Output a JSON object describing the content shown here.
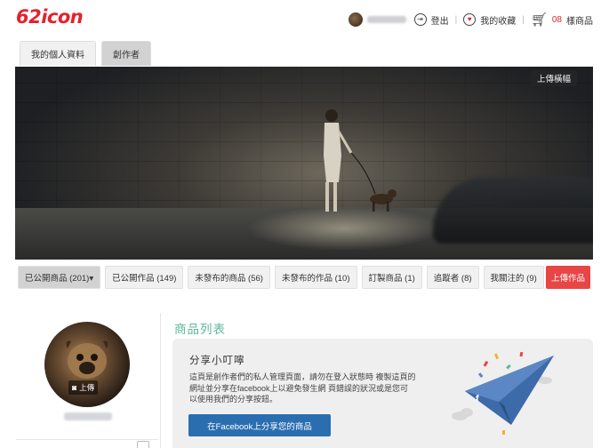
{
  "header": {
    "logo": "62icon",
    "logout_label": "登出",
    "favorites_label": "我的收藏",
    "cart_count": "08",
    "cart_label": "樣商品"
  },
  "tabs": [
    {
      "label": "我的個人資料",
      "active": false
    },
    {
      "label": "創作者",
      "active": true
    }
  ],
  "banner": {
    "upload_label": "上傳橫幅"
  },
  "subtabs": [
    {
      "label": "已公開商品 (201)▾",
      "active": true
    },
    {
      "label": "已公開作品 (149)",
      "active": false
    },
    {
      "label": "未發布的商品 (56)",
      "active": false
    },
    {
      "label": "未發布的作品 (10)",
      "active": false
    },
    {
      "label": "訂製商品 (1)",
      "active": false
    },
    {
      "label": "追蹤者 (8)",
      "active": false
    },
    {
      "label": "我關注的 (9)",
      "active": false
    }
  ],
  "upload_work_label": "上傳作品",
  "profile": {
    "upload_label": "上傳"
  },
  "main": {
    "section_title": "商品列表",
    "tip_title": "分享小叮嚀",
    "tip_body": "這頁是創作者們的私人管理頁面，請勿在登入狀態時 複製這頁的網址並分享在facebook上以避免發生網 頁錯誤的狀況或是您可以使用我們的分享按鈕。",
    "share_button": "在Facebook上分享您的商品"
  },
  "colors": {
    "brand_red": "#e3222d",
    "accent_green": "#5cb79a",
    "facebook_blue": "#2b6eb0",
    "upload_red": "#e94545"
  }
}
